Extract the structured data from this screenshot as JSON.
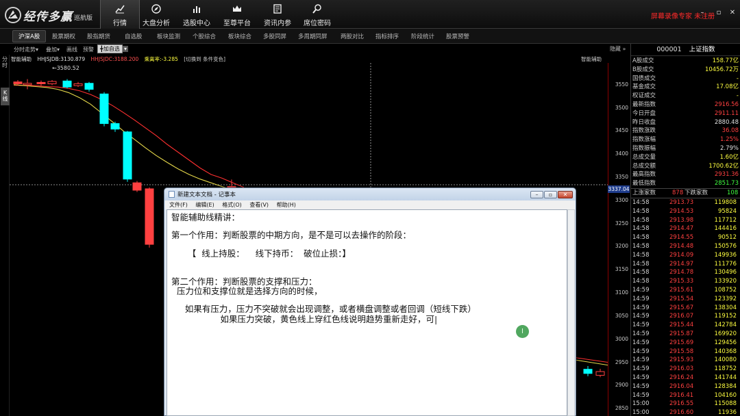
{
  "app": {
    "brand": "经传多赢",
    "edition": "巡航版",
    "warning": "屏幕录像专家 未注册"
  },
  "nav": [
    {
      "label": "行情",
      "icon": "chart-trend-icon"
    },
    {
      "label": "大盘分析",
      "icon": "compass-icon"
    },
    {
      "label": "选股中心",
      "icon": "bar-chart-icon"
    },
    {
      "label": "至尊平台",
      "icon": "crown-icon"
    },
    {
      "label": "资讯内参",
      "icon": "newspaper-icon"
    },
    {
      "label": "席位密码",
      "icon": "magnifier-icon"
    }
  ],
  "subnav": [
    "沪深A股",
    "股票期权",
    "股指期货",
    "自选股",
    "板块监测",
    "个股综合",
    "板块综合",
    "多股同屏",
    "多周期同屏",
    "两股对比",
    "指标排序",
    "阶段统计",
    "股票预警"
  ],
  "chart_toolbar": [
    "分时走势",
    "叠加",
    "画线",
    "预警",
    "加自选"
  ],
  "hide_label": "隐藏",
  "left_tabs": {
    "fenshi": "分时",
    "kline": "K线"
  },
  "indicators": {
    "name": "智能辅助",
    "hh": "HHJSJDB:3130.879",
    "hh2": "HHJSJDC:3188.200",
    "rate": "乘离率:-3.285",
    "switch": "[切换到 条件变色]",
    "right_name": "智能辅助"
  },
  "chart_data": {
    "type": "candlestick",
    "high_label": "3580.52",
    "current_price_tag": "3337.04",
    "y_ticks": [
      "3550",
      "3500",
      "3450",
      "3400",
      "3350",
      "3300",
      "3250",
      "3200",
      "3150",
      "3100",
      "3050",
      "3000",
      "2950",
      "2900",
      "2850"
    ],
    "y_range": [
      2834,
      3597
    ],
    "candles": [
      {
        "o": 3556,
        "c": 3552,
        "h": 3560,
        "l": 3548,
        "color": "#ff4040"
      },
      {
        "o": 3550,
        "c": 3553,
        "h": 3562,
        "l": 3540,
        "color": "#ff4040"
      },
      {
        "o": 3555,
        "c": 3552,
        "h": 3559,
        "l": 3548,
        "color": "#ff4040"
      },
      {
        "o": 3552,
        "c": 3557,
        "h": 3560,
        "l": 3549,
        "color": "#ff4040"
      },
      {
        "o": 3558,
        "c": 3545,
        "h": 3562,
        "l": 3542,
        "color": "#00ffff"
      },
      {
        "o": 3548,
        "c": 3552,
        "h": 3556,
        "l": 3545,
        "color": "#ff4040"
      },
      {
        "o": 3553,
        "c": 3540,
        "h": 3556,
        "l": 3535,
        "color": "#00ffff"
      },
      {
        "o": 3530,
        "c": 3466,
        "h": 3534,
        "l": 3460,
        "color": "#00ffff"
      },
      {
        "o": 3466,
        "c": 3454,
        "h": 3470,
        "l": 3448,
        "color": "#00ffff"
      },
      {
        "o": 3448,
        "c": 3346,
        "h": 3450,
        "l": 3340,
        "color": "#00ffff"
      },
      {
        "o": 3338,
        "c": 3322,
        "h": 3342,
        "l": 3318,
        "color": "#ff4040"
      },
      {
        "o": 3325,
        "c": 3205,
        "h": 3328,
        "l": 3198,
        "color": "#ff4040"
      },
      {
        "o": 3330,
        "c": 3310,
        "h": 3345,
        "l": 3300,
        "color": "#ff4040"
      }
    ],
    "tail_candles": [
      {
        "o": 2935,
        "c": 2926,
        "h": 2942,
        "l": 2920,
        "color": "#00ffff"
      },
      {
        "o": 2922,
        "c": 2930,
        "h": 2936,
        "l": 2918,
        "color": "#ff4040"
      }
    ],
    "ma_red": [
      3549,
      3548,
      3548,
      3546,
      3545,
      3542,
      3537,
      3529,
      3518,
      3505,
      3490,
      3474,
      3457,
      3440,
      3421,
      3404,
      3387,
      3370,
      3356,
      3348,
      3338,
      3328
    ],
    "ma_yellow": [
      3550,
      3548,
      3546,
      3544,
      3540,
      3533,
      3522,
      3508,
      3489,
      3470,
      3450,
      3432,
      3414,
      3397,
      3382,
      3368,
      3356,
      3346,
      3338,
      3330,
      3322,
      3315
    ]
  },
  "quote": {
    "code": "000001",
    "name": "上证指数",
    "rows": [
      {
        "k": "A股成交",
        "v": "158.77亿",
        "color": "#ffff40"
      },
      {
        "k": "B股成交",
        "v": "10456.72万",
        "color": "#ffff40"
      },
      {
        "k": "国债成交",
        "v": "-",
        "color": "#ffff40"
      },
      {
        "k": "基金成交",
        "v": "17.08亿",
        "color": "#ffff40"
      },
      {
        "k": "权证成交",
        "v": "-",
        "color": "#ffff40"
      },
      {
        "k": "最新指数",
        "v": "2916.56",
        "color": "#ff4040"
      },
      {
        "k": "今日开盘",
        "v": "2911.11",
        "color": "#ff4040"
      },
      {
        "k": "昨日收盘",
        "v": "2880.48",
        "color": "#e0e0e0"
      },
      {
        "k": "指数涨跌",
        "v": "36.08",
        "color": "#ff4040"
      },
      {
        "k": "指数涨幅",
        "v": "1.25%",
        "color": "#ff4040"
      },
      {
        "k": "指数振幅",
        "v": "2.79%",
        "color": "#e0e0e0"
      },
      {
        "k": "总成交量",
        "v": "1.60亿",
        "color": "#ffff40"
      },
      {
        "k": "总成交额",
        "v": "1700.62亿",
        "color": "#ffff40"
      },
      {
        "k": "最高指数",
        "v": "2931.36",
        "color": "#ff4040"
      },
      {
        "k": "最低指数",
        "v": "2851.73",
        "color": "#40ff40"
      }
    ],
    "up_label": "上涨家数",
    "up_value": "878",
    "down_label": "下跌家数",
    "down_value": "108"
  },
  "ticks": [
    {
      "t": "14:58",
      "p": "2913.73",
      "v": "119808"
    },
    {
      "t": "14:58",
      "p": "2914.53",
      "v": "95824"
    },
    {
      "t": "14:58",
      "p": "2913.98",
      "v": "117712"
    },
    {
      "t": "14:58",
      "p": "2914.47",
      "v": "144416"
    },
    {
      "t": "14:58",
      "p": "2914.55",
      "v": "90512"
    },
    {
      "t": "14:58",
      "p": "2914.48",
      "v": "150576"
    },
    {
      "t": "14:58",
      "p": "2914.09",
      "v": "149936"
    },
    {
      "t": "14:58",
      "p": "2914.97",
      "v": "111776"
    },
    {
      "t": "14:58",
      "p": "2914.78",
      "v": "130496"
    },
    {
      "t": "14:58",
      "p": "2915.33",
      "v": "133920"
    },
    {
      "t": "14:59",
      "p": "2915.61",
      "v": "108752"
    },
    {
      "t": "14:59",
      "p": "2915.54",
      "v": "123392"
    },
    {
      "t": "14:59",
      "p": "2915.67",
      "v": "138304"
    },
    {
      "t": "14:59",
      "p": "2916.07",
      "v": "119152"
    },
    {
      "t": "14:59",
      "p": "2915.44",
      "v": "142784"
    },
    {
      "t": "14:59",
      "p": "2915.87",
      "v": "169920"
    },
    {
      "t": "14:59",
      "p": "2915.69",
      "v": "129456"
    },
    {
      "t": "14:59",
      "p": "2915.58",
      "v": "140368"
    },
    {
      "t": "14:59",
      "p": "2915.93",
      "v": "140080"
    },
    {
      "t": "14:59",
      "p": "2916.03",
      "v": "118752"
    },
    {
      "t": "14:59",
      "p": "2916.24",
      "v": "141744"
    },
    {
      "t": "14:59",
      "p": "2916.04",
      "v": "128384"
    },
    {
      "t": "14:59",
      "p": "2916.41",
      "v": "104160"
    },
    {
      "t": "15:00",
      "p": "2916.55",
      "v": "115088"
    },
    {
      "t": "15:00",
      "p": "2916.60",
      "v": "11936"
    }
  ],
  "notepad": {
    "title": "新建文本文档 - 记事本",
    "menu": [
      "文件(F)",
      "编辑(E)",
      "格式(O)",
      "查看(V)",
      "帮助(H)"
    ],
    "lines": [
      "智能辅助线精讲：",
      "第一个作用：判断股票的中期方向，是不是可以去操作的阶段：",
      "      【  线上持股：    线下持币：  破位止损：】",
      "第二个作用：判断股票的支撑和压力：",
      "  压力位和支撑位就是选择方向的时候，",
      "     如果有压力，压力不突破就会出现调整，或者横盘调整或者回调（短线下跌）",
      "                  如果压力突破，黄色线上穿红色线说明趋势重新走好，可|"
    ]
  }
}
